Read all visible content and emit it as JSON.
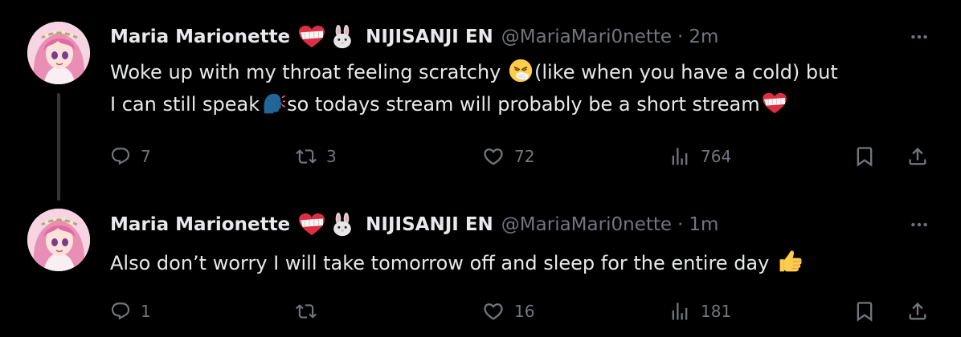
{
  "tweets": [
    {
      "author": "Maria Marionette",
      "affiliation": "NIJISANJI EN",
      "handle": "@MariaMari0nette",
      "separator": "·",
      "time": "2m",
      "text_lines": [
        [
          "Woke up with my throat feeling scratchy ",
          "(like when you have a cold) but"
        ],
        [
          "I can still speak",
          "so todays stream will probably be a short stream"
        ]
      ],
      "stats": {
        "replies": "7",
        "retweets": "3",
        "likes": "72",
        "views": "764"
      }
    },
    {
      "author": "Maria Marionette",
      "affiliation": "NIJISANJI EN",
      "handle": "@MariaMari0nette",
      "separator": "·",
      "time": "1m",
      "text_lines": [
        [
          "Also don’t worry I will take tomorrow off and sleep for the entire day "
        ]
      ],
      "stats": {
        "replies": "1",
        "retweets": "",
        "likes": "16",
        "views": "181"
      }
    }
  ],
  "colors": {
    "background": "#000000",
    "text": "#e7e9ea",
    "muted": "#71767b",
    "thread": "#333639"
  },
  "icons": [
    "reply-icon",
    "retweet-icon",
    "like-icon",
    "views-icon",
    "bookmark-icon",
    "share-icon",
    "more-icon",
    "bandaged-heart-emoji",
    "rabbit-emoji",
    "sneezing-face-emoji",
    "speaking-head-emoji",
    "thumbs-up-emoji"
  ]
}
